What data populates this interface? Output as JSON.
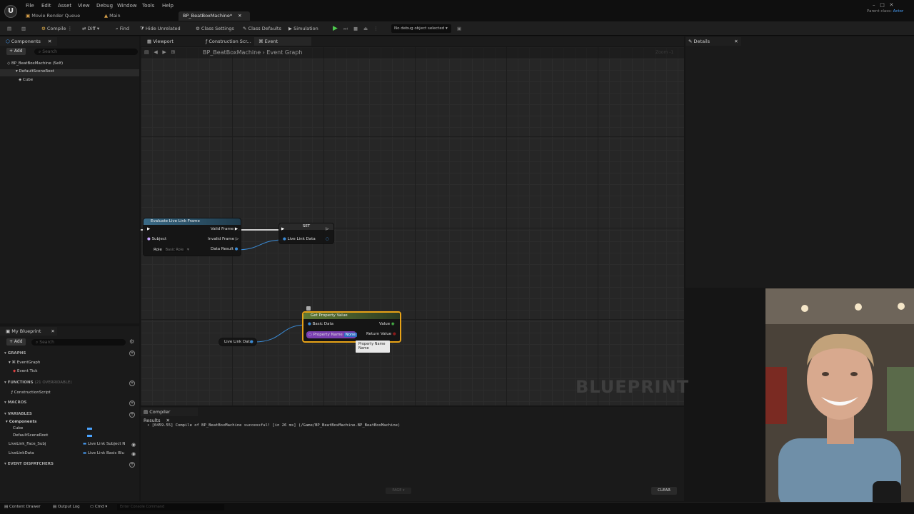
{
  "menus": [
    "File",
    "Edit",
    "Asset",
    "View",
    "Debug",
    "Window",
    "Tools",
    "Help"
  ],
  "doc_tabs": {
    "movie_render_queue": "Movie Render Queue",
    "main": "Main",
    "blueprint": "BP_BeatBoxMachine*"
  },
  "parent_class": {
    "label": "Parent class:",
    "value": "Actor"
  },
  "toolbar": {
    "compile": "Compile",
    "diff": "Diff",
    "find": "Find",
    "hide_unrelated": "Hide Unrelated",
    "class_settings": "Class Settings",
    "class_defaults": "Class Defaults",
    "simulation": "Simulation",
    "debug_object": "No debug object selected"
  },
  "components": {
    "title": "Components",
    "add": "+ Add",
    "search_placeholder": "Search",
    "items": [
      "BP_BeatBoxMachine (Self)",
      "DefaultSceneRoot",
      "Cube"
    ]
  },
  "editor_tabs": {
    "viewport": "Viewport",
    "construction": "Construction Scr...",
    "event_graph": "Event Graph"
  },
  "breadcrumb": {
    "blueprint": "BP_BeatBoxMachine",
    "graph": "Event Graph",
    "zoom": "Zoom -1"
  },
  "details": {
    "title": "Details"
  },
  "nodes": {
    "evaluate": {
      "title": "Evaluate Live Link Frame",
      "subject": "Subject",
      "role": "Role",
      "role_value": "Basic Role",
      "valid": "Valid Frame",
      "invalid": "Invalid Frame",
      "data": "Data Result"
    },
    "set": {
      "title": "SET",
      "pin": "Live Link Data"
    },
    "get_property": {
      "title": "Get Property Value",
      "basic_data": "Basic Data",
      "property_name": "Property Name",
      "property_value": "None",
      "value": "Value",
      "return_value": "Return Value"
    },
    "variable": {
      "label": "Live Link Data"
    },
    "tooltip": {
      "line1": "Property Name",
      "line2": "Name"
    }
  },
  "watermark": "BLUEPRINT",
  "my_blueprint": {
    "title": "My Blueprint",
    "add": "+ Add",
    "search_placeholder": "Search",
    "graphs_header": "GRAPHS",
    "event_graph": "EventGraph",
    "event_tick": "Event Tick",
    "functions_header": "FUNCTIONS",
    "functions_count": "(21 OVERRIDABLE)",
    "construction_script": "ConstructionScript",
    "macros_header": "MACROS",
    "variables_header": "VARIABLES",
    "components_header": "Components",
    "variables": [
      {
        "name": "Cube",
        "type": ""
      },
      {
        "name": "DefaultSceneRoot",
        "type": ""
      },
      {
        "name": "LiveLink_Face_Subj",
        "type": "Live Link Subject N"
      },
      {
        "name": "LiveLinkData",
        "type": "Live Link Basic Blu"
      }
    ],
    "dispatchers_header": "EVENT DISPATCHERS"
  },
  "compiler": {
    "title": "Compiler Results",
    "message": "[0459.55] Compile of BP_BeatBoxMachine successful! [in 26 ms] (/Game/BP_BeatBoxMachine.BP_BeatBoxMachine)",
    "page": "PAGE",
    "clear": "CLEAR"
  },
  "bottom": {
    "content_drawer": "Content Drawer",
    "output_log": "Output Log",
    "cmd": "Cmd",
    "console_placeholder": "Enter Console Command"
  }
}
